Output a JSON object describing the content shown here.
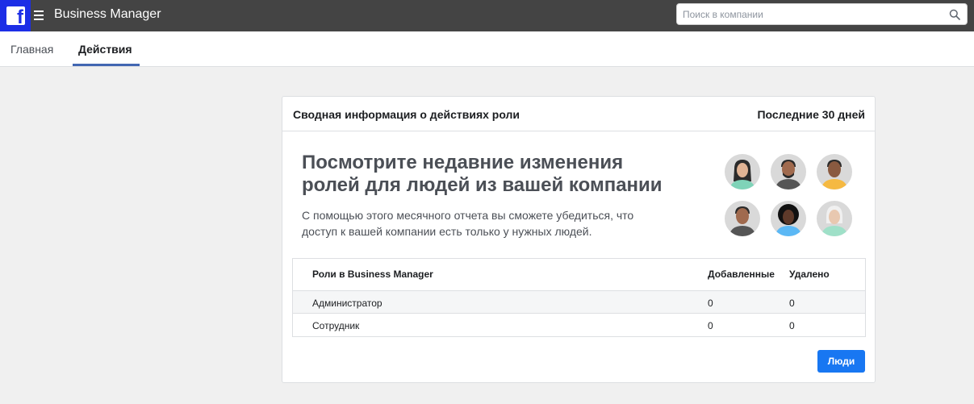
{
  "header": {
    "logo_icon": "facebook-logo",
    "menu_icon": "hamburger-icon",
    "app_title": "Business Manager",
    "search": {
      "placeholder": "Поиск в компании",
      "value": "",
      "icon": "search-icon"
    }
  },
  "nav": {
    "tabs": [
      {
        "label": "Главная",
        "active": false
      },
      {
        "label": "Действия",
        "active": true
      }
    ]
  },
  "card": {
    "title": "Сводная информация о действиях роли",
    "period": "Последние 30 дней",
    "promo": {
      "heading": "Посмотрите недавние изменения ролей для людей из вашей компании",
      "description": "С помощью этого месячного отчета вы сможете убедиться, что доступ к вашей компании есть только у нужных людей."
    },
    "avatars": [
      {
        "icon": "person-avatar-icon",
        "shirt": "#7fd3b8",
        "hair": "#2b2b2b",
        "skin": "#e0b394"
      },
      {
        "icon": "person-avatar-icon",
        "shirt": "#555555",
        "hair": "#2b2b2b",
        "skin": "#a06a4e"
      },
      {
        "icon": "person-avatar-icon",
        "shirt": "#f5b942",
        "hair": "#2b2b2b",
        "skin": "#8a5a40"
      },
      {
        "icon": "person-avatar-icon",
        "shirt": "#555555",
        "hair": "#2b2b2b",
        "skin": "#a06a4e"
      },
      {
        "icon": "person-avatar-icon",
        "shirt": "#5bb8f5",
        "hair": "#111111",
        "skin": "#5e3a2a"
      },
      {
        "icon": "person-avatar-icon",
        "shirt": "#9fe0c8",
        "hair": "#f0f0f0",
        "skin": "#e8c8b0"
      }
    ],
    "table": {
      "columns": [
        "Роли в Business Manager",
        "Добавленные",
        "Удалено"
      ],
      "rows": [
        [
          "Администратор",
          "0",
          "0"
        ],
        [
          "Сотрудник",
          "0",
          "0"
        ]
      ]
    },
    "people_button": "Люди"
  },
  "colors": {
    "topbar": "#444444",
    "logo_bg": "#1c2ee6",
    "accent": "#4267b2",
    "button": "#1877f2"
  }
}
